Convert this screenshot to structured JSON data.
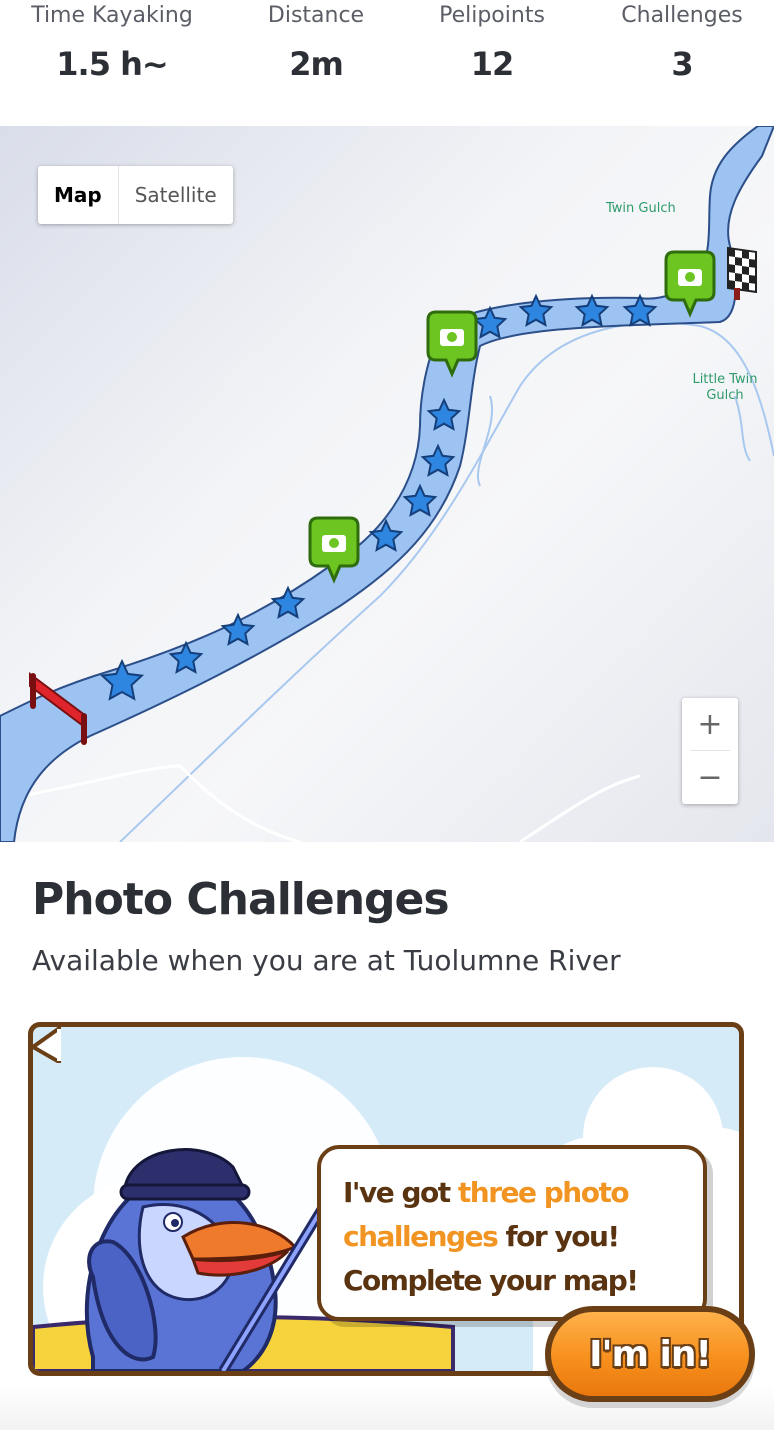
{
  "stats": [
    {
      "label": "Time Kayaking",
      "value": "1.5 h~"
    },
    {
      "label": "Distance",
      "value": "2m"
    },
    {
      "label": "Pelipoints",
      "value": "12"
    },
    {
      "label": "Challenges",
      "value": "3"
    }
  ],
  "map": {
    "type_control": {
      "map_label": "Map",
      "satellite_label": "Satellite",
      "selected": "Map"
    },
    "zoom": {
      "in_label": "+",
      "out_label": "−"
    },
    "places": {
      "twin_gulch": "Twin Gulch",
      "little_twin_gulch": "Little Twin Gulch"
    },
    "icons": [
      "start-flag-icon",
      "star-icon",
      "camera-pin-icon",
      "finish-flag-icon"
    ],
    "river_color": "#9dc3f2",
    "star_color": "#2f86e0",
    "camera_pin_color": "#6cc521"
  },
  "photo_challenges": {
    "title": "Photo Challenges",
    "subtitle": "Available when you are at Tuolumne River",
    "bubble": {
      "line1_prefix": "I've got ",
      "line1_highlight": "three photo",
      "line2_highlight": "challenges",
      "line2_suffix": " for you!",
      "line3": "Complete your map!"
    },
    "cta_label": "I'm in!",
    "accent_color": "#f29422",
    "frame_color": "#6b3f16"
  }
}
